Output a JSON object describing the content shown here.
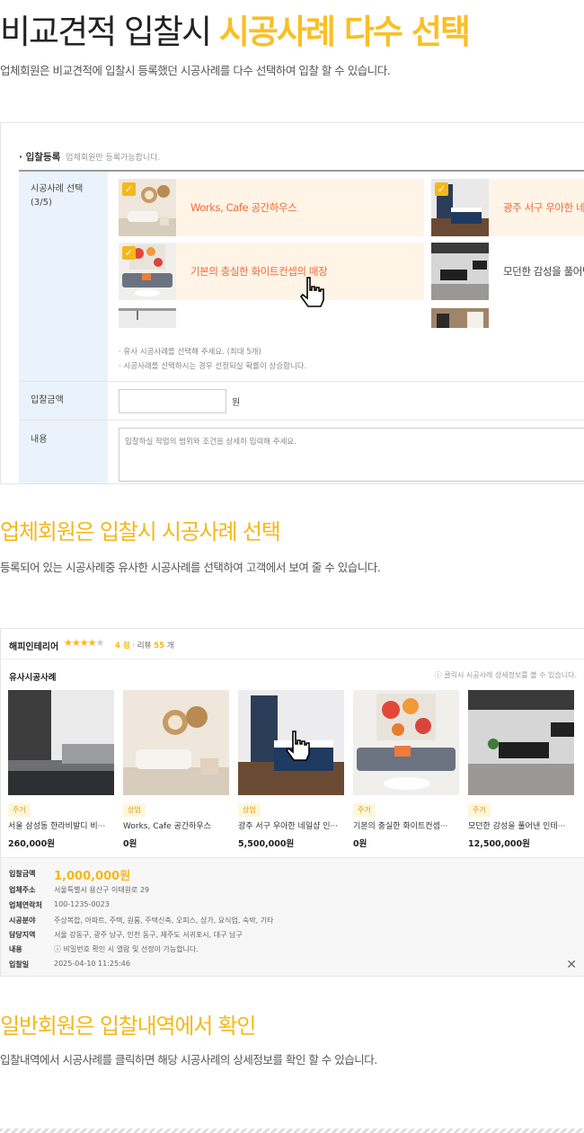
{
  "section1": {
    "title_plain": "비교견적 입찰시 ",
    "title_highlight": "시공사례 다수 선택",
    "desc": "업체회원은 비교견적에 입찰시 등록했던 시공사례를 다수 선택하여 입찰 할 수 있습니다."
  },
  "form": {
    "title": "· 입찰등록",
    "subtitle": "업체회원만 등록가능합니다.",
    "case_label": "시공사례 선택",
    "case_count": "(3/5)",
    "cases": [
      {
        "label": "Works, Cafe 공간하우스",
        "checked": true
      },
      {
        "label": "광주 서구 우아한 네일샵",
        "checked": true
      },
      {
        "label": "기본의 충실한 화이트컨셉의 매장",
        "checked": true
      },
      {
        "label": "모던한 감성을 풀어낸 인테리어",
        "checked": false
      }
    ],
    "notes": [
      "· 유사 시공사례를 선택해 주세요. (최대 5개)",
      "· 시공사례를 선택하시는 경우 선정되실 확률이 상승합니다."
    ],
    "price_label": "입찰금액",
    "price_unit": "원",
    "content_label": "내용",
    "content_placeholder": "입찰하실 작업의 범위와 조건을 상세히 입력해 주세요."
  },
  "section2": {
    "title": "업체회원은 입찰시 시공사례 선택",
    "desc": "등록되어 있는 시공사례중 유사한 시공사례를 선택하여 고객에서 보여 줄 수 있습니다."
  },
  "company": {
    "name": "해피인테리어",
    "stars_on": "★★★★",
    "stars_off": "★",
    "score": "4 점",
    "review_prefix": "· 리뷰",
    "review_count": "55",
    "review_suffix": "개",
    "section_title": "유사시공사례",
    "hint": "ⓘ 클릭시 시공사례 상세정보를 볼 수 있습니다.",
    "cards": [
      {
        "tag": "주거",
        "title": "서울 삼성동 한라비발디 비···",
        "price": "260,000원"
      },
      {
        "tag": "상업",
        "title": "Works, Cafe 공간하우스",
        "price": "0원"
      },
      {
        "tag": "상업",
        "title": "광주 서구 우아한 네일샵 인···",
        "price": "5,500,000원"
      },
      {
        "tag": "주거",
        "title": "기본의 충실한 화이트컨셉···",
        "price": "0원"
      },
      {
        "tag": "주거",
        "title": "모던한 감성을 풀어낸 인테···",
        "price": "12,500,000원"
      }
    ],
    "info": [
      {
        "k": "입찰금액",
        "v": "1,000,000원"
      },
      {
        "k": "업체주소",
        "v": "서울특별시 용산구 이태원로 29"
      },
      {
        "k": "업체연락처",
        "v": "100-1235-0023"
      },
      {
        "k": "시공분야",
        "v": "주상복합, 아파트, 주택, 원룸, 주택신축, 오피스, 상가, 요식업, 숙박, 기타"
      },
      {
        "k": "담당지역",
        "v": "서울 강동구, 광주 남구, 인천 동구, 제주도 서귀포시, 대구 남구"
      },
      {
        "k": "내용",
        "v": "ⓘ 비밀번호 확인 시 열람 및 선정이 가능합니다."
      },
      {
        "k": "입찰일",
        "v": "2025-04-10 11:25:46"
      }
    ],
    "close": "✕"
  },
  "section3": {
    "title": "일반회원은 입찰내역에서 확인",
    "desc": "입찰내역에서 시공사례를 클릭하면 해당 시공사례의 상세정보를 확인 할 수 있습니다."
  },
  "colors": {
    "accent": "#f5b81a",
    "highlight_bg": "#fff4e6",
    "label_bg": "#eaf3fb",
    "case_text": "#f06a3a"
  }
}
